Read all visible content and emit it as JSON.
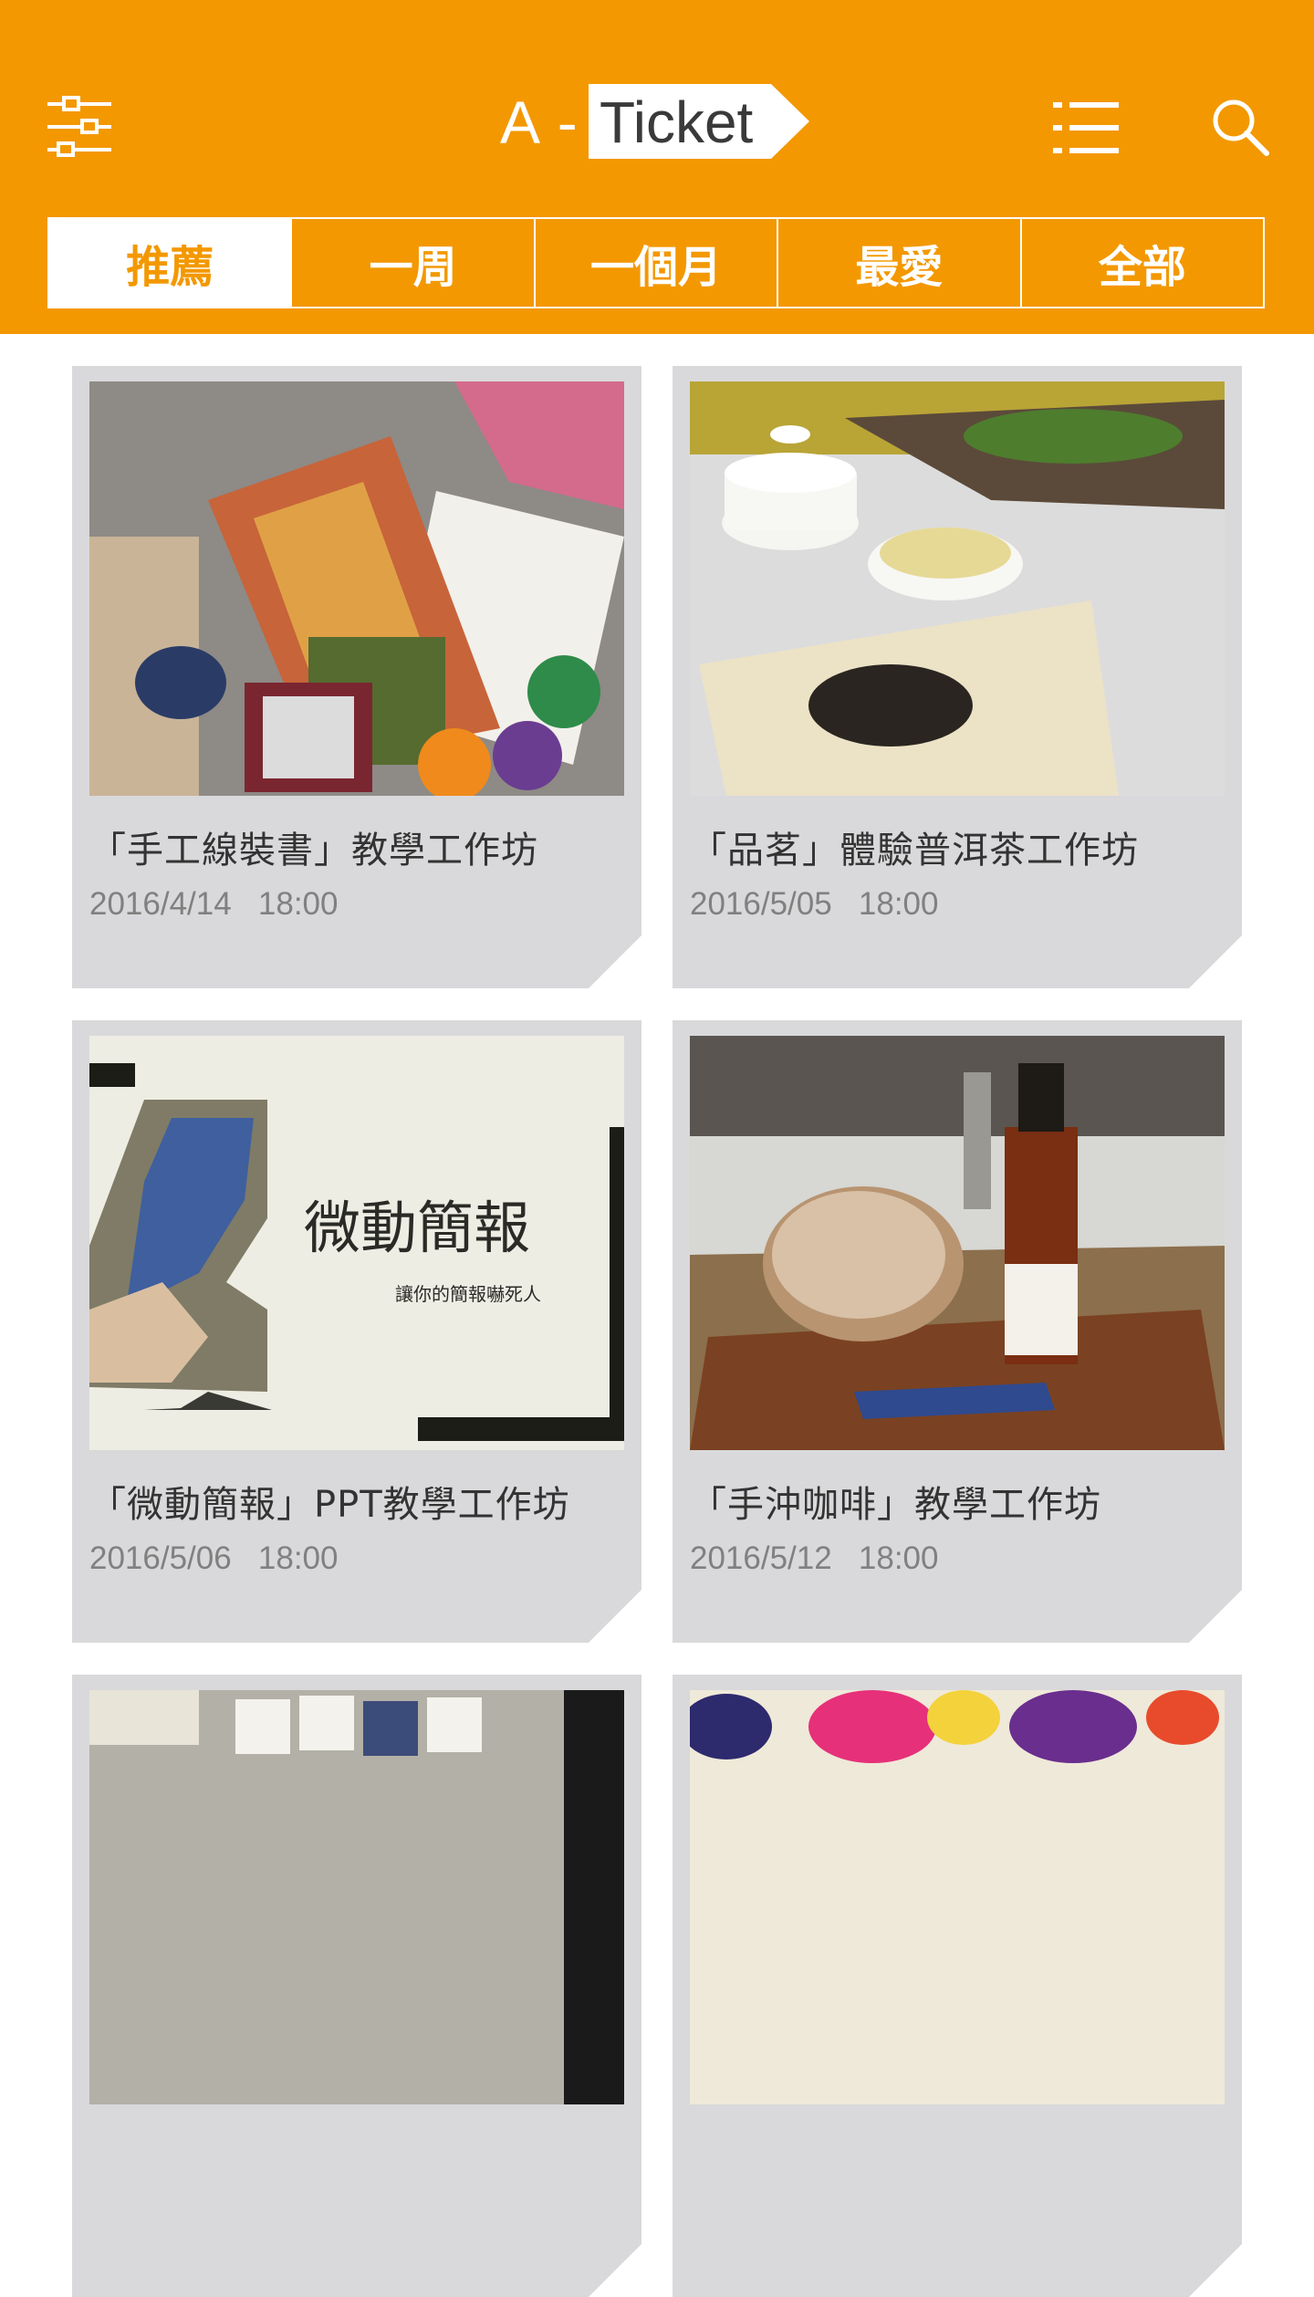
{
  "header": {
    "logo_prefix": "A -",
    "logo_word": "Ticket",
    "filter_icon": "sliders-icon",
    "list_icon": "list-icon",
    "search_icon": "search-icon"
  },
  "tabs": [
    {
      "label": "推薦",
      "active": true
    },
    {
      "label": "一周",
      "active": false
    },
    {
      "label": "一個月",
      "active": false
    },
    {
      "label": "最愛",
      "active": false
    },
    {
      "label": "全部",
      "active": false
    }
  ],
  "events": [
    {
      "title": "「手工線裝書」教學工作坊",
      "date": "2016/4/14",
      "time": "18:00"
    },
    {
      "title": "「品茗」體驗普洱茶工作坊",
      "date": "2016/5/05",
      "time": "18:00"
    },
    {
      "title": "「微動簡報」PPT教學工作坊",
      "date": "2016/5/06",
      "time": "18:00",
      "image_text": {
        "heading": "微動簡報",
        "sub": "讓你的簡報嚇死人"
      }
    },
    {
      "title": "「手沖咖啡」教學工作坊",
      "date": "2016/5/12",
      "time": "18:00"
    }
  ],
  "colors": {
    "brand": "#f39800",
    "card_bg": "#d9d9db",
    "title_text": "#333333",
    "date_text": "#808080"
  }
}
